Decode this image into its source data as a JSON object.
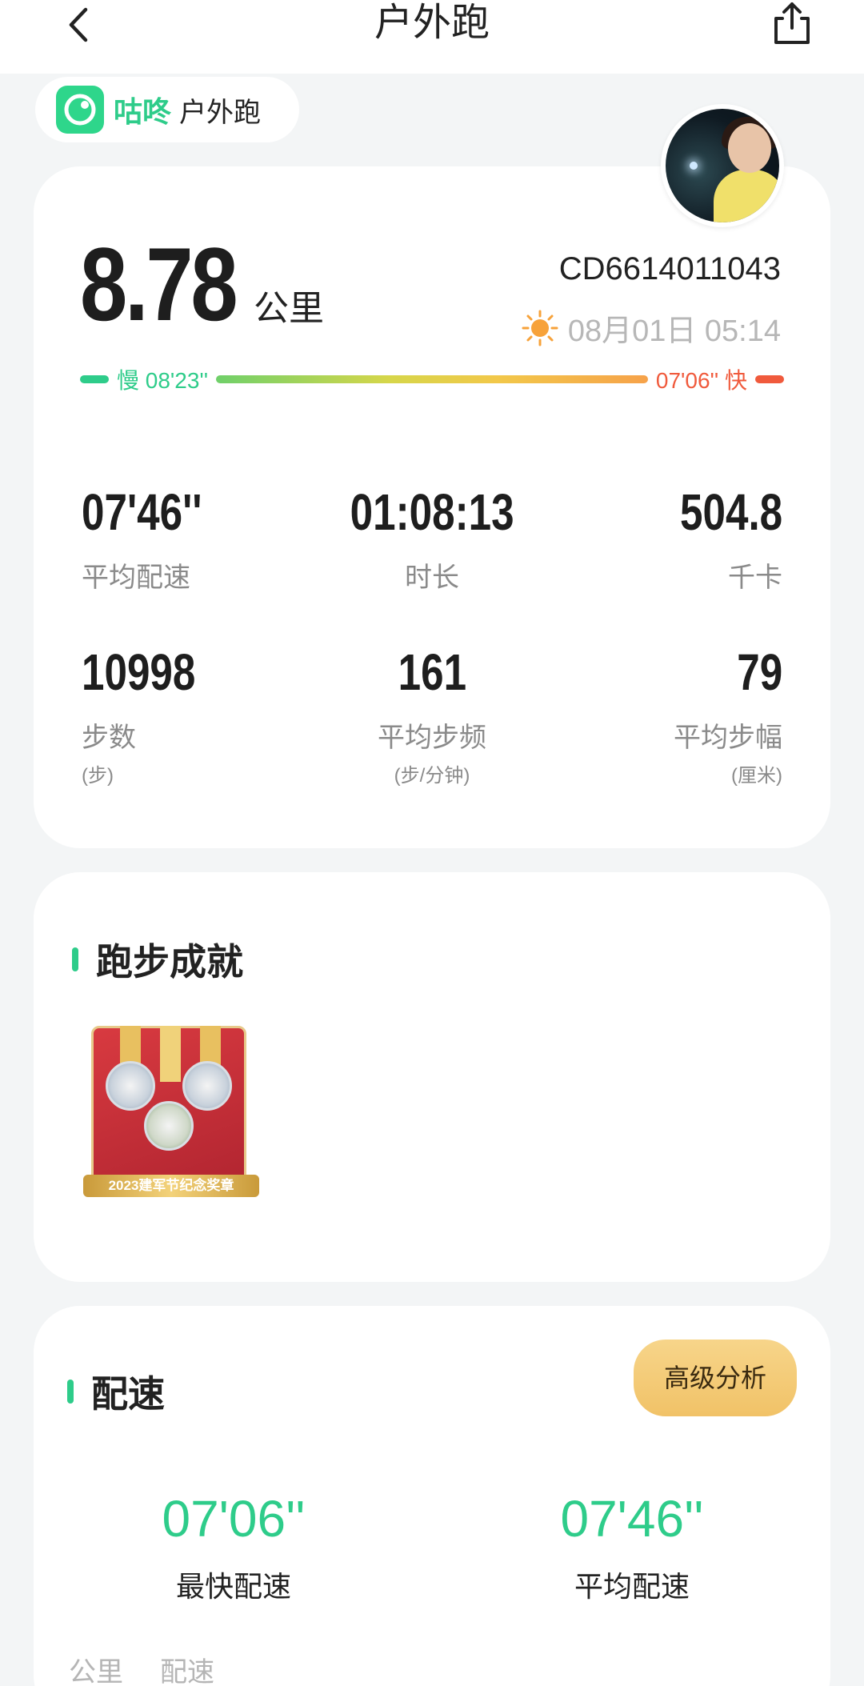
{
  "header": {
    "title": "户外跑"
  },
  "brand": {
    "name": "咕咚",
    "sport": "户外跑"
  },
  "summary": {
    "distance": "8.78",
    "distance_unit": "公里",
    "record_id": "CD6614011043",
    "date": "08月01日 05:14",
    "slow_label": "慢 08'23''",
    "fast_label": "07'06'' 快"
  },
  "stats": [
    {
      "value": "07'46''",
      "label": "平均配速",
      "sub": ""
    },
    {
      "value": "01:08:13",
      "label": "时长",
      "sub": ""
    },
    {
      "value": "504.8",
      "label": "千卡",
      "sub": ""
    },
    {
      "value": "10998",
      "label": "步数",
      "sub": "(步)"
    },
    {
      "value": "161",
      "label": "平均步频",
      "sub": "(步/分钟)"
    },
    {
      "value": "79",
      "label": "平均步幅",
      "sub": "(厘米)"
    }
  ],
  "achievements": {
    "title": "跑步成就",
    "medal_caption": "2023建军节纪念奖章"
  },
  "pace": {
    "title": "配速",
    "advanced_button": "高级分析",
    "fastest_value": "07'06''",
    "fastest_label": "最快配速",
    "average_value": "07'46''",
    "average_label": "平均配速",
    "tabs": [
      "公里",
      "配速"
    ]
  },
  "colors": {
    "accent": "#2ecc8a",
    "fast": "#f05a3c",
    "button": "#f3c66f"
  },
  "icons": {
    "back": "chevron-left-icon",
    "share": "share-icon",
    "weather": "sun-icon",
    "brand": "codoon-logo-icon"
  }
}
